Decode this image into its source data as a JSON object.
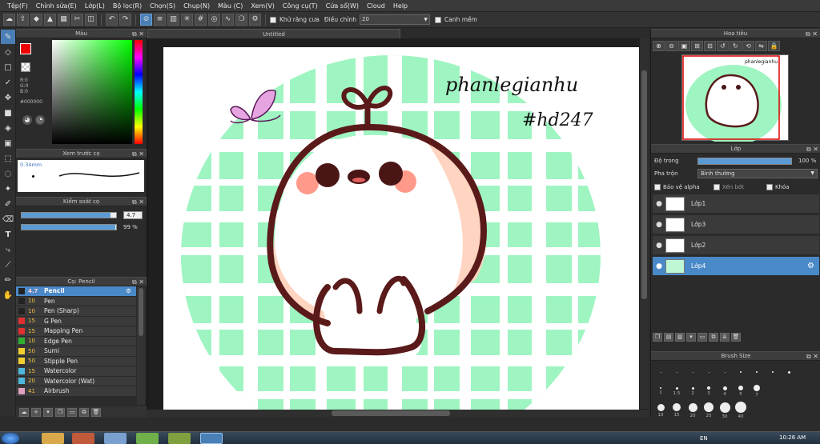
{
  "menu": [
    "Tệp(F)",
    "Chỉnh sửa(E)",
    "Lớp(L)",
    "Bộ lọc(R)",
    "Chọn(S)",
    "Chụp(N)",
    "Màu (C)",
    "Xem(V)",
    "Công cụ(T)",
    "Cửa sổ(W)",
    "Cloud",
    "Help"
  ],
  "toolbar": {
    "antialias_label": "Khử răng cưa",
    "adjust_label": "Điều chỉnh",
    "adjust_value": "20",
    "snap_label": "Canh mềm"
  },
  "color_panel": {
    "title": "Màu",
    "r": "R:0",
    "g": "G:0",
    "b": "B:0",
    "hex": "#000000",
    "fg_color": "#e00000",
    "bg_color": "#000000"
  },
  "brush_preview": {
    "title": "Xem trước cọ",
    "size_label": "0.34mm"
  },
  "brush_control": {
    "title": "Kiểm soát cọ",
    "size_value": "4.7",
    "opacity_value": "99 %",
    "opacity_fraction": 0.99,
    "size_fraction": 0.94
  },
  "brush_list": {
    "title": "Cọ: Pencil",
    "items": [
      {
        "size": "4.7",
        "name": "Pencil",
        "color": "#222222",
        "selected": true
      },
      {
        "size": "10",
        "name": "Pen",
        "color": "#222222"
      },
      {
        "size": "10",
        "name": "Pen (Sharp)",
        "color": "#222222"
      },
      {
        "size": "15",
        "name": "G Pen",
        "color": "#e03030"
      },
      {
        "size": "15",
        "name": "Mapping Pen",
        "color": "#e03030"
      },
      {
        "size": "10",
        "name": "Edge Pen",
        "color": "#30b030"
      },
      {
        "size": "50",
        "name": "Sumi",
        "color": "#f0d030"
      },
      {
        "size": "50",
        "name": "Stipple Pen",
        "color": "#f0d030"
      },
      {
        "size": "15",
        "name": "Watercolor",
        "color": "#50b8e0"
      },
      {
        "size": "20",
        "name": "Watercolor (Wat)",
        "color": "#50b8e0"
      },
      {
        "size": "41",
        "name": "Airbrush",
        "color": "#e0a0c0"
      }
    ]
  },
  "canvas": {
    "tab_title": "Untitled",
    "text_line1": "phanlegianhu",
    "text_line2": "#hd247"
  },
  "navigator": {
    "title": "Hoa tiêu"
  },
  "layers_panel": {
    "title": "Lớp",
    "opacity_label": "Độ trong",
    "opacity_value": "100 %",
    "blend_label": "Pha trộn",
    "blend_value": "Bình thường",
    "protect_alpha": "Bảo vệ alpha",
    "clipping": "Xén bớt",
    "lock": "Khóa",
    "layers": [
      {
        "name": "Lớp1",
        "selected": false
      },
      {
        "name": "Lớp3",
        "selected": false
      },
      {
        "name": "Lớp2",
        "selected": false
      },
      {
        "name": "Lớp4",
        "selected": true
      }
    ]
  },
  "brush_size_panel": {
    "title": "Brush Size",
    "row1_labels": [
      "1",
      "1.5",
      "2",
      "3",
      "4",
      "5",
      "7"
    ],
    "row2_labels": [
      "10",
      "15",
      "20",
      "25",
      "30",
      "40"
    ]
  },
  "taskbar": {
    "lang": "EN",
    "time": "10:26 AM"
  }
}
